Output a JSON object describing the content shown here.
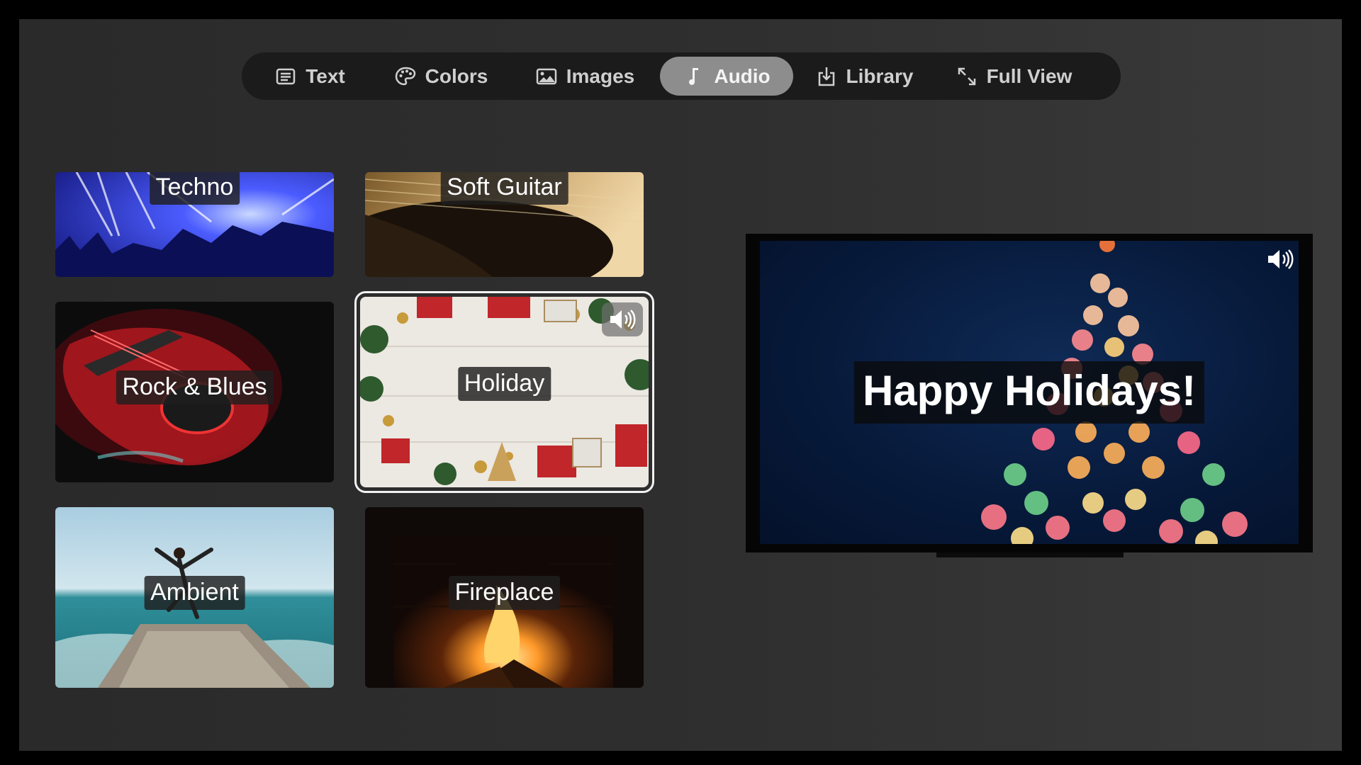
{
  "tabs": [
    {
      "label": "Text",
      "icon": "text-icon",
      "active": false
    },
    {
      "label": "Colors",
      "icon": "palette-icon",
      "active": false
    },
    {
      "label": "Images",
      "icon": "image-icon",
      "active": false
    },
    {
      "label": "Audio",
      "icon": "music-note-icon",
      "active": true
    },
    {
      "label": "Library",
      "icon": "download-tray-icon",
      "active": false
    },
    {
      "label": "Full View",
      "icon": "expand-arrows-icon",
      "active": false
    }
  ],
  "tiles": [
    {
      "label": "Techno",
      "image": "concert crowd with blue stage lights"
    },
    {
      "label": "Soft Guitar",
      "image": "acoustic guitar close-up"
    },
    {
      "label": "Rock & Blues",
      "image": "red electric guitar in dark"
    },
    {
      "label": "Holiday",
      "image": "christmas decorations on white wood",
      "selected": true,
      "playing": true
    },
    {
      "label": "Ambient",
      "image": "dancer on a pier by the sea"
    },
    {
      "label": "Fireplace",
      "image": "burning fireplace"
    }
  ],
  "preview": {
    "title": "Happy Holidays!",
    "background": "bokeh christmas tree lights",
    "speaker_icon": "speaker-icon"
  }
}
